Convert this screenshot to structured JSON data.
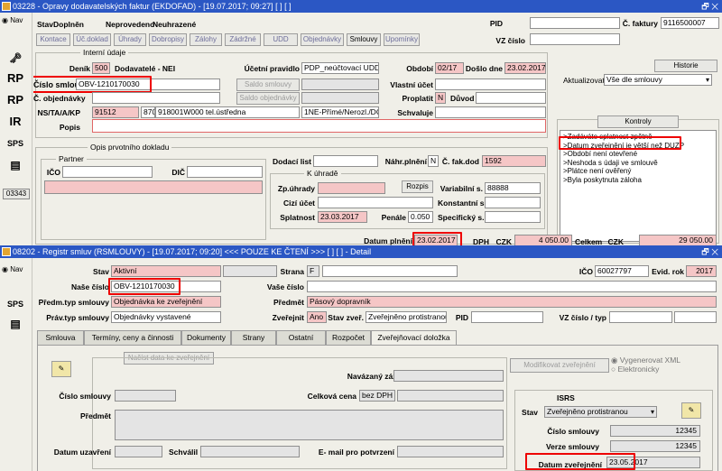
{
  "win1": {
    "title": "03228 - Opravy dodavatelských faktur (EKDOFAD) - [19.07.2017; 09:27]  [ ] [ ]",
    "nav": "Nav",
    "side_code": "03343",
    "status": {
      "stav_label": "Stav",
      "stav_value": "Doplněn",
      "a": "Neprovedeno",
      "b": "Neuhrazené"
    },
    "pid_label": "PID",
    "cfak_label": "Č. faktury",
    "cfak_value": "9116500007",
    "vz_label": "VZ číslo",
    "tabs": [
      "Kontace",
      "Úč.doklad",
      "Úhrady",
      "Dobropisy",
      "Zálohy",
      "Zádržné",
      "UDD",
      "Objednávky",
      "Smlouvy",
      "Upomínky"
    ],
    "interni": "Interní údaje",
    "denik_label": "Deník",
    "denik_value": "500",
    "dodavatele": "Dodavatelé - NEI",
    "ucet_prav_label": "Účetní pravidlo",
    "ucet_prav_value": "PDP_neúčtovací UDD",
    "obdobi_label": "Období",
    "obdobi_value": "02/17",
    "doslo_label": "Došlo dne",
    "doslo_value": "23.02.2017",
    "historie": "Historie",
    "cislo_smlouvy_label": "Číslo smlouvy",
    "cislo_smlouvy_value": "OBV-1210170030",
    "saldo_smlouvy": "Saldo smlouvy",
    "saldo_objednavky": "Saldo objednávky",
    "vlastni_ucet_label": "Vlastní účet",
    "aktualizovat_label": "Aktualizovat",
    "aktualizovat_value": "Vše dle smlouvy",
    "c_obj_label": "Č. objednávky",
    "proplatit_label": "Proplatit",
    "proplatit_value": "N",
    "duvod_label": "Důvod",
    "ns_label": "NS/TA/A/KP",
    "ns1": "91512",
    "ns2": "870",
    "ns3": "918001W000 tel.ústředna",
    "ns4": "1NE-Přímé/Nerozl./DČ-Ekd",
    "schvaluje_label": "Schvaluje",
    "popis_label": "Popis",
    "kontroly": "Kontroly",
    "kontroly_items": [
      ">Zadáváte splatnost zpětně",
      ">Datum zveřejnění je větší než DUZP",
      ">Období není otevřené",
      ">Neshoda s údaji ve smlouvě",
      ">Plátce není ověřený",
      ">Byla poskytnuta záloha"
    ],
    "opis": "Opis prvotního dokladu",
    "partner": "Partner",
    "ico_label": "IČO",
    "dic_label": "DIČ",
    "dodaci_label": "Dodací list",
    "nahr_label": "Náhr.plnění",
    "nahr_value": "N",
    "cfakdod_label": "Č. fak.dod",
    "cfakdod_value": "1592",
    "k_uhrade": "K úhradě",
    "zpuhrady_label": "Zp.úhrady",
    "rozpis": "Rozpis",
    "varsym_label": "Variabilní s.",
    "varsym_value": "88888",
    "cizi_label": "Cizí účet",
    "konst_label": "Konstantní s.",
    "splat_label": "Splatnost",
    "splat_value": "23.03.2017",
    "penale_label": "Penále",
    "penale_value": "0.050",
    "specif_label": "Specifický s.",
    "datum_plneni_label": "Datum plnění",
    "datum_plneni_value": "23.02.2017",
    "dph_label": "DPH",
    "czk1": "CZK",
    "dph_value": "4 050.00",
    "celkem_label": "Celkem",
    "czk2": "CZK",
    "celkem_value": "29 050.00"
  },
  "win2": {
    "title": "08202 - Registr smluv (RSMLOUVY) - [19.07.2017; 09:20] <<< POUZE KE ČTENÍ >>>  [ ] [ ] - Detail",
    "nav": "Nav",
    "stav_label": "Stav",
    "stav_value": "Aktivní",
    "strana_label": "Strana",
    "strana_value": "F",
    "ico_label": "IČO",
    "ico_value": "60027797",
    "evid_label": "Evid. rok",
    "evid_value": "2017",
    "nase_label": "Naše číslo",
    "nase_value": "OBV-1210170030",
    "vase_label": "Vaše číslo",
    "predmtyp_label": "Předm.typ smlouvy",
    "predmtyp_value": "Objednávka ke zveřejnění",
    "predmet_label": "Předmět",
    "predmet_value": "Pásový dopravník",
    "pravtyp_label": "Práv.typ smlouvy",
    "pravtyp_value": "Objednávky vystavené",
    "zverejnit_label": "Zveřejnit",
    "zverejnit_value": "Ano",
    "stavzver_label": "Stav zveř.",
    "stavzver_value": "Zveřejněno protistranou",
    "pid_label": "PID",
    "vz_label": "VZ číslo / typ",
    "tabs": [
      "Smlouva",
      "Termíny, ceny a činnosti",
      "Dokumenty",
      "Strany",
      "Ostatní",
      "Rozpočet",
      "Zveřejňovací doložka"
    ],
    "nacist": "Načíst data ke zveřejnění",
    "modif": "Modifikovat zveřejnění",
    "vygen": "Vygenerovat XML",
    "elektr": "Elektronicky",
    "navaz_label": "Navázaný záznam",
    "cislo_sml_label": "Číslo smlouvy",
    "celk_cena_label": "Celková cena",
    "celk_cena_value": "bez DPH",
    "predmet2_label": "Předmět",
    "isrs": "ISRS",
    "isrs_stav_label": "Stav",
    "isrs_stav_value": "Zveřejněno protistranou",
    "isrs_cislo_label": "Číslo smlouvy",
    "isrs_cislo_value": "12345",
    "isrs_verze_label": "Verze smlouvy",
    "isrs_verze_value": "12345",
    "isrs_datum_label": "Datum zveřejnění",
    "isrs_datum_value": "23.05.2017",
    "datum_uzav_label": "Datum uzavření",
    "schvalil_label": "Schválil",
    "email_label": "E- mail pro potvrzení"
  }
}
